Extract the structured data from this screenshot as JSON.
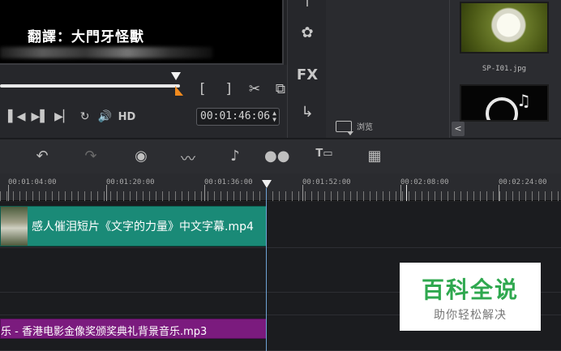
{
  "preview": {
    "subtitle": "翻譯：大門牙怪獸"
  },
  "player": {
    "mark_in": "[",
    "mark_out": "]",
    "split": "✂",
    "copy": "⧉",
    "prev": "◀▌",
    "step_back": "▌◀",
    "step_forward": "▶▌",
    "next": "▶▏",
    "repeat": "↻",
    "volume": "🔊",
    "hd": "HD",
    "timecode": "00:01:46:06"
  },
  "tools": {
    "fx": "FX"
  },
  "library": {
    "browse_label": "浏览",
    "thumb1_label": "SP-I01.jpg",
    "scroll_left": "<"
  },
  "timeline": {
    "toolbar_icons": [
      "undo-icon",
      "redo-icon",
      "record-icon",
      "audio-mix-icon",
      "auto-music-icon",
      "motion-track-icon",
      "title-icon",
      "multicam-icon"
    ],
    "ticks": [
      "00:01:04:00",
      "00:01:20:00",
      "00:01:36:00",
      "00:01:52:00",
      "00:02:08:00",
      "00:02:24:00"
    ],
    "video_clip": "感人催泪短片《文字的力量》中文字幕.mp4",
    "audio_clip": "乐 - 香港电影金像奖颁奖典礼背景音乐.mp3"
  },
  "watermark": {
    "title": "百科全说",
    "subtitle": "助你轻松解决"
  }
}
